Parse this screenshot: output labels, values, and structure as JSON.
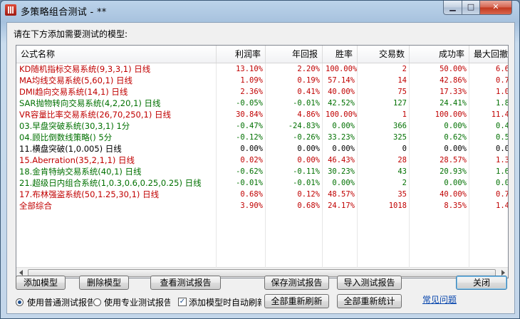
{
  "window": {
    "title": "多策略组合测试 - **",
    "min_icon": "minimize-icon",
    "max_icon": "maximize-icon",
    "close_icon": "close-icon"
  },
  "prompt": "请在下方添加需要测试的模型:",
  "columns": [
    "公式名称",
    "利润率",
    "年回报",
    "胜率",
    "交易数",
    "成功率",
    "最大回撤"
  ],
  "colors": {
    "red": "#c00000",
    "green": "#007000",
    "black": "#000000"
  },
  "rows": [
    {
      "name": "KD随机指标交易系统(9,3,3,1) 日线",
      "color": "red",
      "vals": [
        "13.10%",
        "2.20%",
        "100.00%",
        "2",
        "50.00%",
        "6.6"
      ]
    },
    {
      "name": "MA均线交易系统(5,60,1) 日线",
      "color": "red",
      "vals": [
        "1.09%",
        "0.19%",
        "57.14%",
        "14",
        "42.86%",
        "0.7"
      ]
    },
    {
      "name": "DMI趋向交易系统(14,1) 日线",
      "color": "red",
      "vals": [
        "2.36%",
        "0.41%",
        "40.00%",
        "75",
        "17.33%",
        "1.0"
      ]
    },
    {
      "name": "SAR抛物转向交易系统(4,2,20,1) 日线",
      "color": "green",
      "vals": [
        "-0.05%",
        "-0.01%",
        "42.52%",
        "127",
        "24.41%",
        "1.8"
      ]
    },
    {
      "name": "VR容量比率交易系统(26,70,250,1) 日线",
      "color": "red",
      "vals": [
        "30.84%",
        "4.86%",
        "100.00%",
        "1",
        "100.00%",
        "11.4"
      ]
    },
    {
      "name": "03.早盘突破系统(30,3,1) 1分",
      "color": "green",
      "vals": [
        "-0.47%",
        "-24.83%",
        "0.00%",
        "366",
        "0.00%",
        "0.4"
      ]
    },
    {
      "name": "04.顾比倒数线策略() 5分",
      "color": "green",
      "vals": [
        "-0.12%",
        "-0.26%",
        "33.23%",
        "325",
        "0.62%",
        "0.5"
      ]
    },
    {
      "name": "11.横盘突破(1,0.005) 日线",
      "color": "black",
      "vals": [
        "0.00%",
        "0.00%",
        "0.00%",
        "0",
        "0.00%",
        "0.0"
      ]
    },
    {
      "name": "15.Aberration(35,2,1,1) 日线",
      "color": "red",
      "vals": [
        "0.02%",
        "0.00%",
        "46.43%",
        "28",
        "28.57%",
        "1.3"
      ]
    },
    {
      "name": "18.金肯特纳交易系统(40,1) 日线",
      "color": "green",
      "vals": [
        "-0.62%",
        "-0.11%",
        "30.23%",
        "43",
        "20.93%",
        "1.6"
      ]
    },
    {
      "name": "21.超级日内组合系统(1,0.3,0.6,0.25,0.25) 日线",
      "color": "green",
      "vals": [
        "-0.01%",
        "-0.01%",
        "0.00%",
        "2",
        "0.00%",
        "0.0"
      ]
    },
    {
      "name": "17.布林强盗系统(50,1.25,30,1) 日线",
      "color": "red",
      "vals": [
        "0.68%",
        "0.12%",
        "48.57%",
        "35",
        "40.00%",
        "0.7"
      ]
    },
    {
      "name": "全部综合",
      "color": "red",
      "vals": [
        "3.90%",
        "0.68%",
        "24.17%",
        "1018",
        "8.35%",
        "1.4"
      ]
    }
  ],
  "buttons": {
    "add_model": "添加模型",
    "delete_model": "删除模型",
    "view_report": "查看测试报告",
    "save_report": "保存测试报告",
    "import_report": "导入测试报告",
    "close": "关闭",
    "refresh_all": "全部重新刷新",
    "recount_all": "全部重新统计"
  },
  "options": {
    "normal_test": "使用普通测试报告",
    "pro_test": "使用专业测试报告",
    "auto_refresh": "添加模型时自动刷新",
    "normal_selected": true,
    "pro_selected": false,
    "auto_checked": true
  },
  "faq_link": "常见问题"
}
